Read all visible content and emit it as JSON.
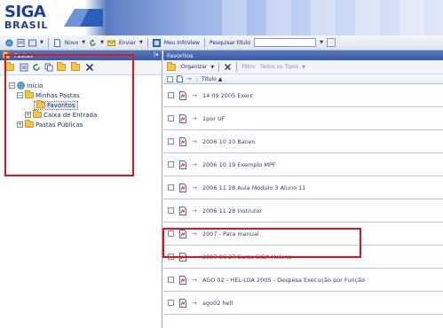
{
  "branding": {
    "logo_top": "SIGA",
    "logo_bottom": "BRASIL"
  },
  "toolbar": {
    "new_label": "Novo",
    "send_label": "Enviar",
    "infoview_label": "Meu InfoView",
    "search_label": "Pesquisar título",
    "search_value": ""
  },
  "left_panel": {
    "title": "Pastas",
    "tree": [
      {
        "label": "Início",
        "level": 0
      },
      {
        "label": "Minhas Pastas",
        "level": 1
      },
      {
        "label": "Favoritos",
        "level": 2
      },
      {
        "label": "Caixa de Entrada",
        "level": 2
      },
      {
        "label": "Pastas Públicas",
        "level": 1
      }
    ]
  },
  "right_panel": {
    "title": "Favoritos",
    "organize_label": "Organizar",
    "filter_label": "Filtro:",
    "filter_value": "Todos os Tipos",
    "column_title": "Título ▲",
    "rows": [
      "14 09 2005 Exerc",
      "1por UF",
      "2006 10 10 Bacen",
      "2006 10 19 Exemplo MPF",
      "2006 11 28 Aula Módulo 3 Aluno 11",
      "2006 11 28 Instrutor",
      "2007 - Para manual",
      "2007 06 27 Curso SIGA Helena",
      "AGO 02 - HEL-LOA 2005 - Despesa Execução por Função",
      "ago02 hell"
    ]
  },
  "colors": {
    "highlight": "#e0141b",
    "header_blue": "#3a5ba4",
    "folder_yellow": "#f3c64d"
  }
}
